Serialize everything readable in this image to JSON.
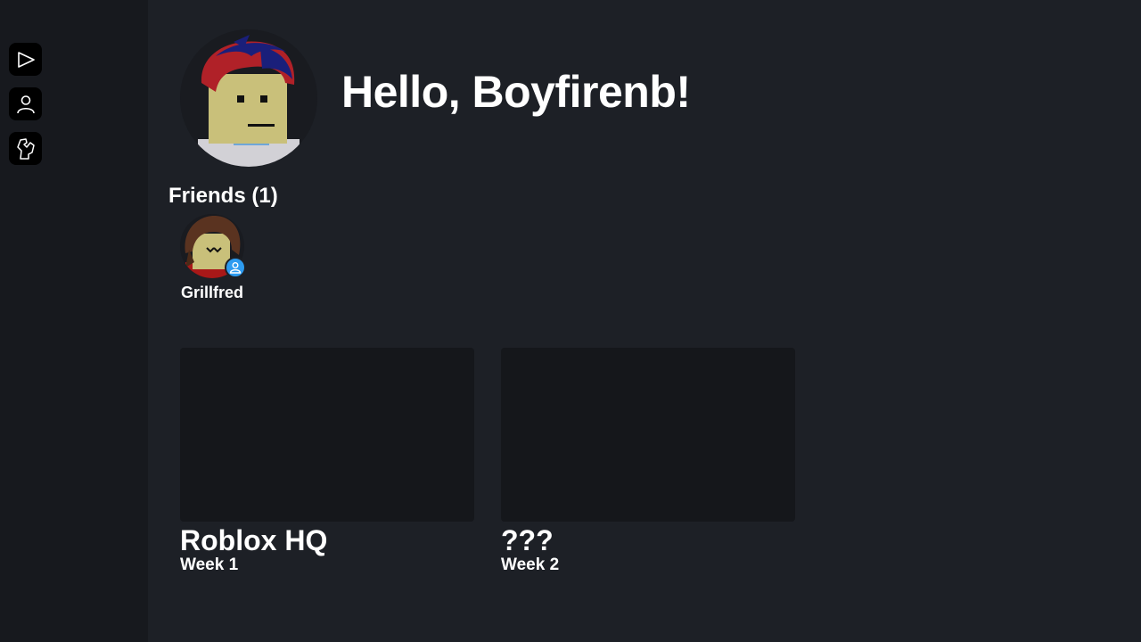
{
  "sidebar": {
    "items": [
      {
        "icon": "play-icon"
      },
      {
        "icon": "profile-icon"
      },
      {
        "icon": "avatar-editor-icon"
      }
    ]
  },
  "header": {
    "greeting": "Hello, Boyfirenb!"
  },
  "friends": {
    "title": "Friends (1)",
    "list": [
      {
        "name": "Grillfred",
        "status_icon": "online-user-icon"
      }
    ]
  },
  "experiences": [
    {
      "title": "Roblox HQ",
      "subtitle": "Week 1"
    },
    {
      "title": "???",
      "subtitle": "Week 2"
    }
  ],
  "colors": {
    "background": "#1d2026",
    "sidebar": "#17191e",
    "card": "#15171b",
    "presence": "#2d9bf0"
  }
}
